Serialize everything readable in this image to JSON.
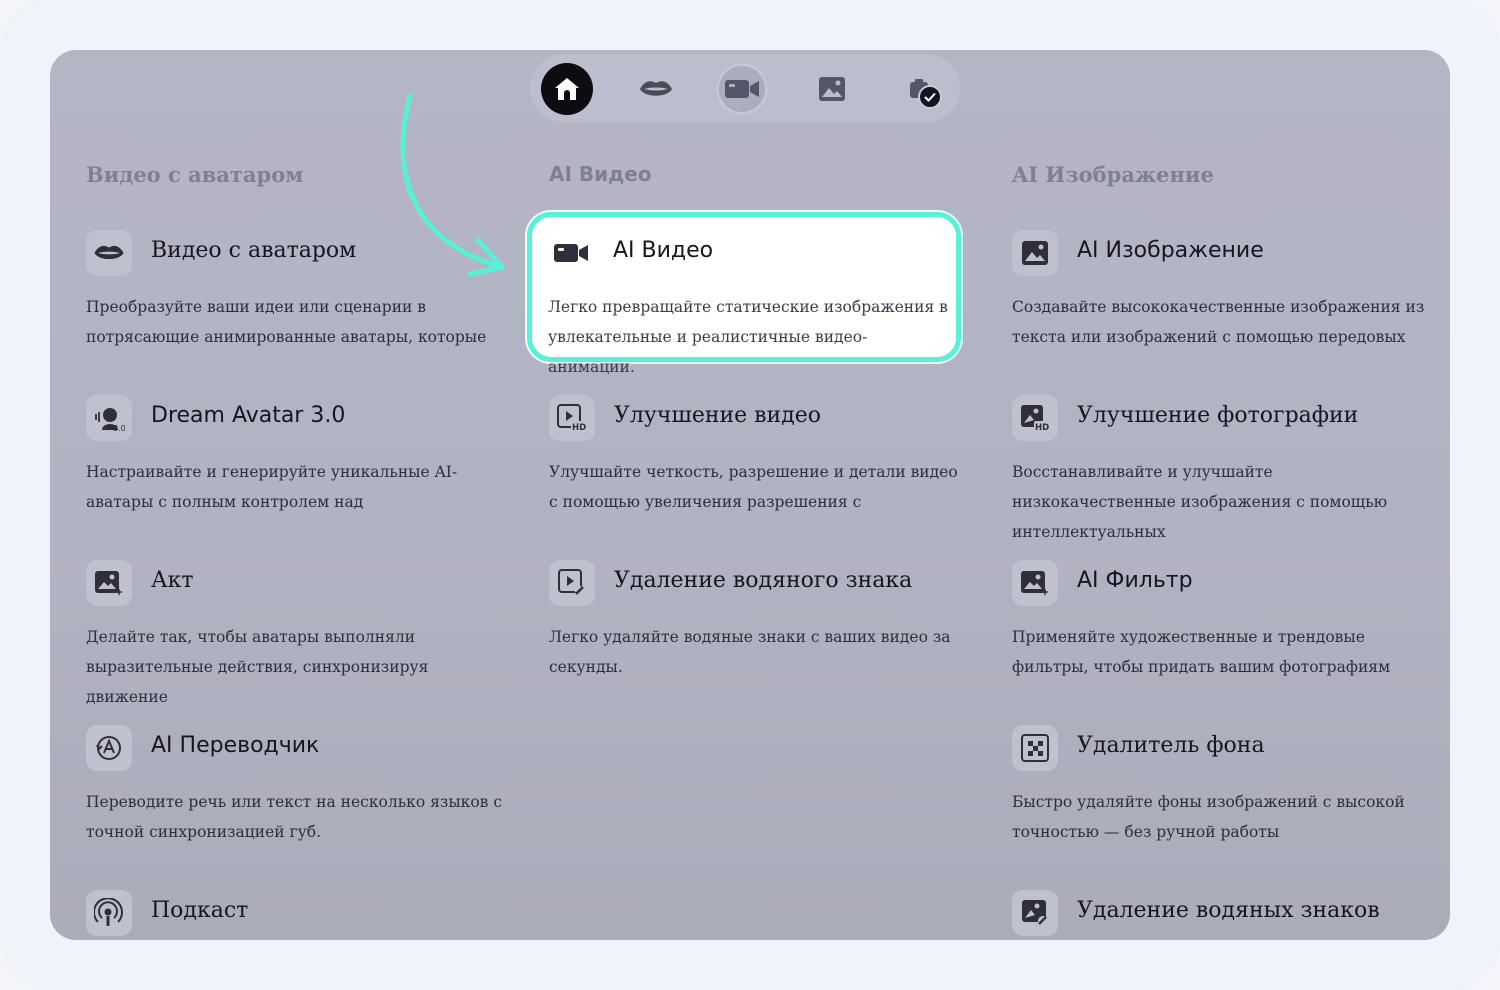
{
  "nav": {
    "items": [
      {
        "name": "home",
        "icon": "home-icon"
      },
      {
        "name": "lips",
        "icon": "lips-icon"
      },
      {
        "name": "video",
        "icon": "video-camera-icon"
      },
      {
        "name": "image",
        "icon": "image-icon"
      },
      {
        "name": "camera",
        "icon": "camera-check-icon"
      }
    ]
  },
  "columns": [
    {
      "title": "Видео с аватаром",
      "cards": [
        {
          "title": "Видео с аватаром",
          "desc": "Преобразуйте ваши идеи или сценарии в потрясающие анимированные аватары, которые",
          "icon": "lips-icon"
        },
        {
          "title": "Dream Avatar 3.0",
          "desc": "Настраивайте и генерируйте уникальные AI-аватары с полным контролем над",
          "icon": "dream-avatar-icon"
        },
        {
          "title": "Акт",
          "desc": "Делайте так, чтобы аватары выполняли выразительные действия, синхронизируя движение",
          "icon": "act-icon"
        },
        {
          "title": "AI Переводчик",
          "desc": "Переводите речь или текст на несколько языков с точной синхронизацией губ.",
          "icon": "translator-icon"
        },
        {
          "title": "Подкаст",
          "desc": "",
          "icon": "podcast-icon"
        }
      ]
    },
    {
      "title": "AI Видео",
      "cards": [
        {
          "title": "AI Видео",
          "desc": "Легко превращайте статические изображения в увлекательные и реалистичные видео-анимации.",
          "icon": "video-camera-icon"
        },
        {
          "title": "Улучшение видео",
          "desc": "Улучшайте четкость, разрешение и детали видео с помощью увеличения разрешения с",
          "icon": "video-hd-icon"
        },
        {
          "title": "Удаление водяного знака",
          "desc": "Легко удаляйте водяные знаки с ваших видео за секунды.",
          "icon": "video-watermark-icon"
        }
      ]
    },
    {
      "title": "AI Изображение",
      "cards": [
        {
          "title": "AI Изображение",
          "desc": "Создавайте высококачественные изображения из текста или изображений с помощью передовых",
          "icon": "image-icon"
        },
        {
          "title": "Улучшение фотографии",
          "desc": "Восстанавливайте и улучшайте низкокачественные изображения с помощью интеллектуальных",
          "icon": "image-hd-icon"
        },
        {
          "title": "AI Фильтр",
          "desc": "Применяйте художественные и трендовые фильтры, чтобы придать вашим фотографиям",
          "icon": "filter-icon"
        },
        {
          "title": "Удалитель фона",
          "desc": "Быстро удаляйте фоны изображений с высокой точностью — без ручной работы",
          "icon": "background-remover-icon"
        },
        {
          "title": "Удаление водяных знаков",
          "desc": "",
          "icon": "image-watermark-icon"
        }
      ]
    }
  ],
  "colors": {
    "highlight_border": "#57f1d5",
    "arrow": "#57f1d5",
    "panel": "#b3b4c3"
  }
}
